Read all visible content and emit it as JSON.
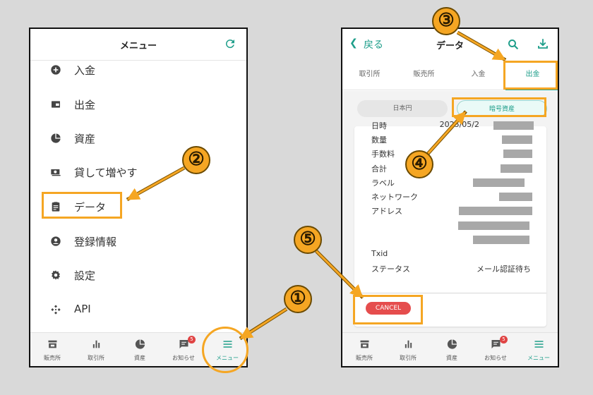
{
  "left_screen": {
    "header_title": "メニュー",
    "menu": [
      {
        "label": "入金",
        "icon": "plus-circle-icon"
      },
      {
        "label": "出金",
        "icon": "wallet-icon"
      },
      {
        "label": "資産",
        "icon": "pie-chart-icon"
      },
      {
        "label": "貸して増やす",
        "icon": "cash-icon"
      },
      {
        "label": "データ",
        "icon": "clipboard-icon"
      },
      {
        "label": "登録情報",
        "icon": "account-icon"
      },
      {
        "label": "設定",
        "icon": "gear-icon"
      },
      {
        "label": "API",
        "icon": "api-icon"
      }
    ],
    "tabs": [
      {
        "label": "販売所",
        "icon": "store-icon"
      },
      {
        "label": "取引所",
        "icon": "bar-chart-icon"
      },
      {
        "label": "資産",
        "icon": "pie-chart-icon"
      },
      {
        "label": "お知らせ",
        "icon": "message-icon",
        "badge": "5"
      },
      {
        "label": "メニュー",
        "icon": "hamburger-icon",
        "active": true
      }
    ]
  },
  "right_screen": {
    "back_label": "戻る",
    "header_title": "データ",
    "top_tabs": [
      {
        "label": "取引所"
      },
      {
        "label": "販売所"
      },
      {
        "label": "入金"
      },
      {
        "label": "出金",
        "active": true
      }
    ],
    "segments": {
      "left": "日本円",
      "right": "暗号資産"
    },
    "rows": [
      {
        "label": "日時",
        "value": "2025/05/2"
      },
      {
        "label": "数量",
        "value": ""
      },
      {
        "label": "手数料",
        "value": ""
      },
      {
        "label": "合計",
        "value": ""
      },
      {
        "label": "ラベル",
        "value": ""
      },
      {
        "label": "ネットワーク",
        "value": ""
      },
      {
        "label": "アドレス",
        "value": ""
      },
      {
        "label": "Txid",
        "value": ""
      },
      {
        "label": "ステータス",
        "value": "メール認証待ち"
      }
    ],
    "cancel_label": "CANCEL",
    "tabs": [
      {
        "label": "販売所",
        "icon": "store-icon"
      },
      {
        "label": "取引所",
        "icon": "bar-chart-icon"
      },
      {
        "label": "資産",
        "icon": "pie-chart-icon"
      },
      {
        "label": "お知らせ",
        "icon": "message-icon",
        "badge": "5"
      },
      {
        "label": "メニュー",
        "icon": "hamburger-icon",
        "active": true
      }
    ]
  },
  "annotations": {
    "steps": [
      "①",
      "②",
      "③",
      "④",
      "⑤"
    ]
  },
  "colors": {
    "accent": "#1e9e8a",
    "highlight": "#f5a623",
    "cancel": "#e54d4d",
    "badge": "#e04444"
  }
}
